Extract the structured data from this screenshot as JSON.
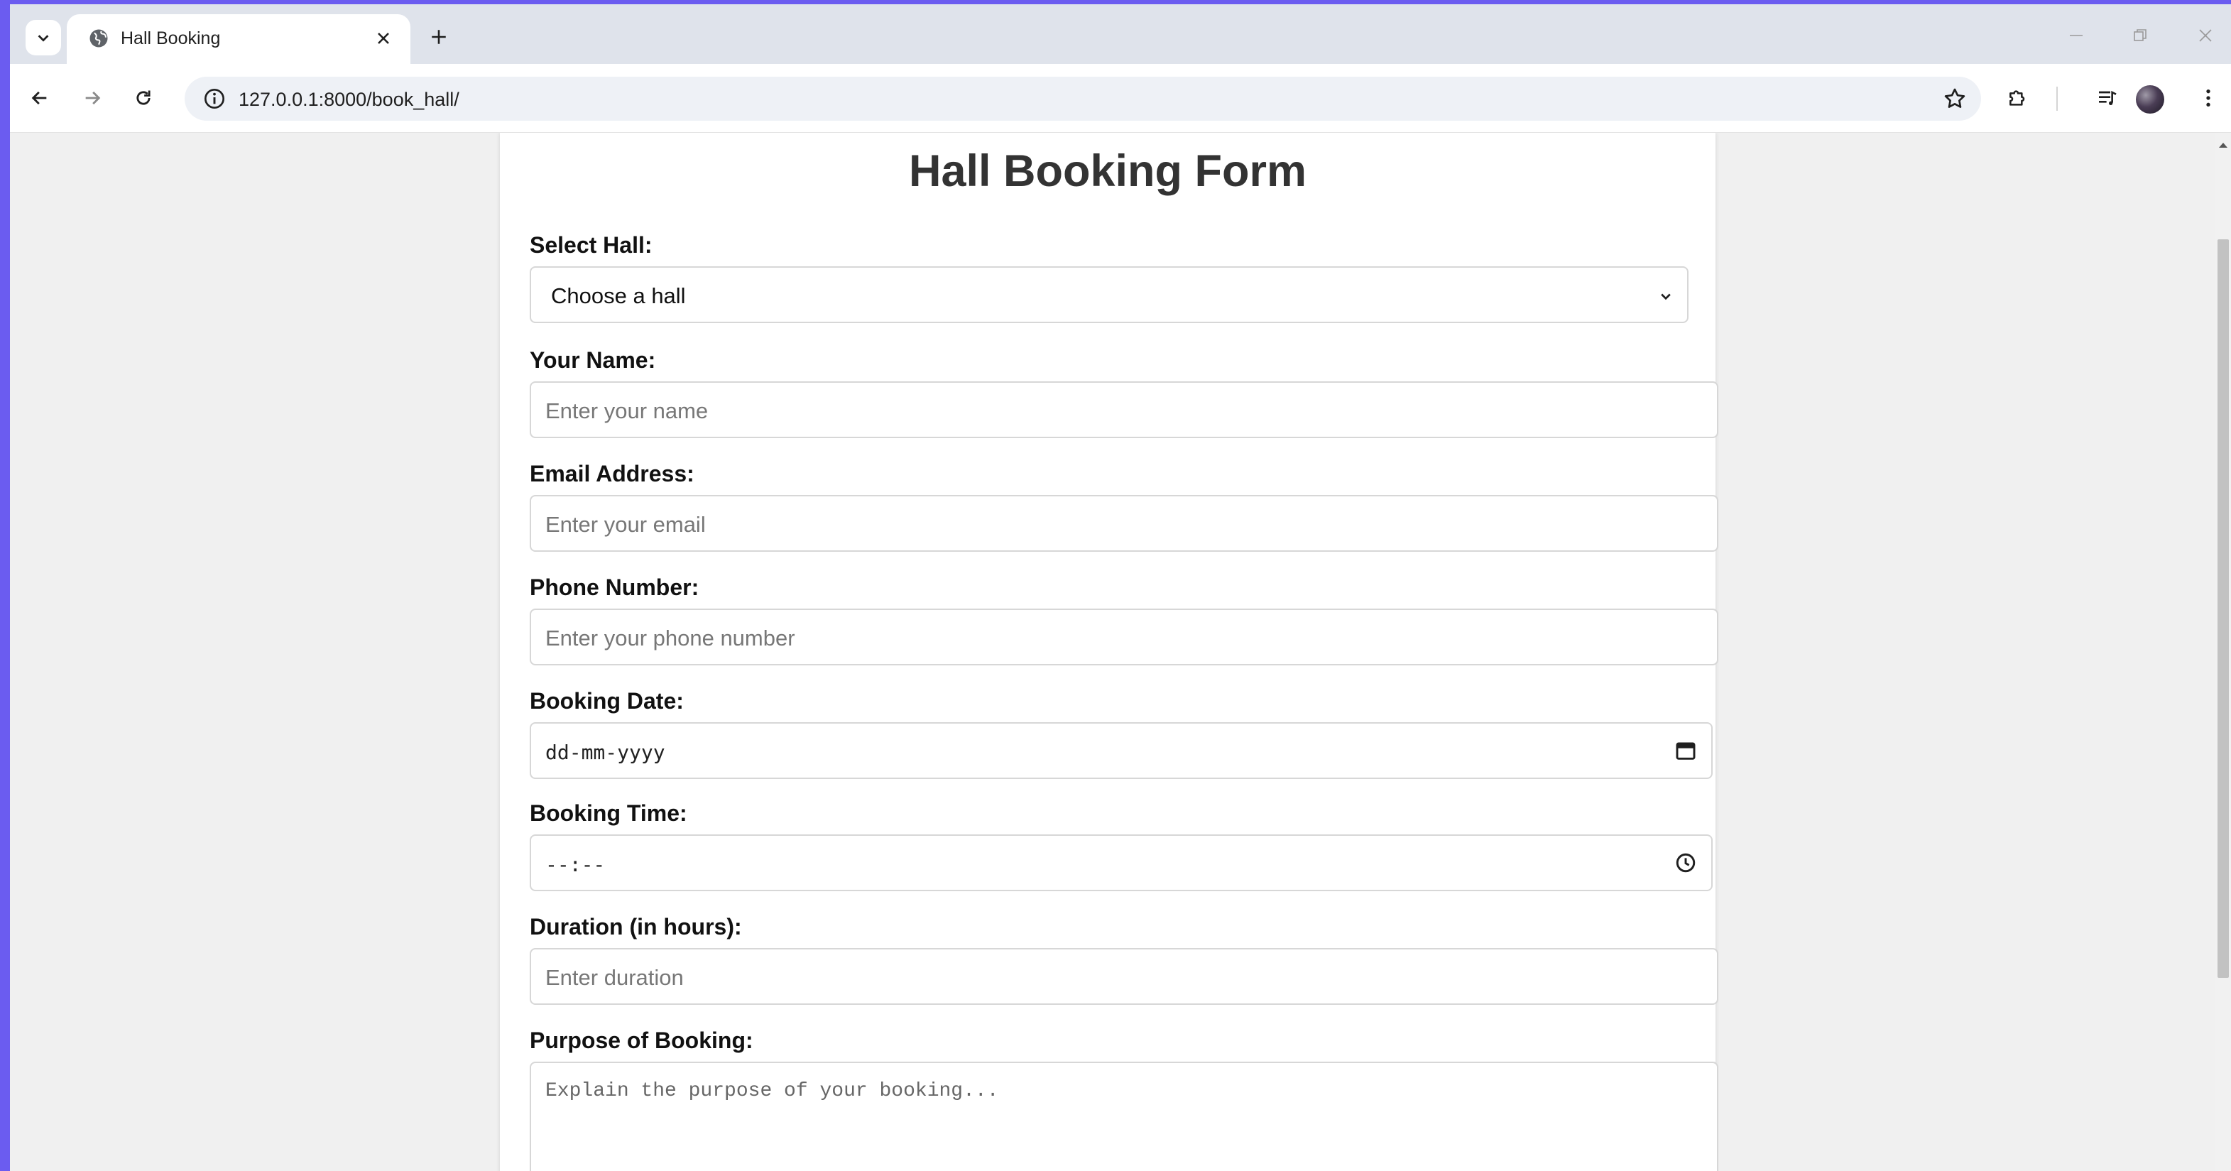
{
  "browser": {
    "tab": {
      "title": "Hall Booking",
      "favicon": "globe-icon"
    },
    "url": "127.0.0.1:8000/book_hall/"
  },
  "form": {
    "title": "Hall Booking Form",
    "hall": {
      "label": "Select Hall:",
      "selected": "Choose a hall"
    },
    "name": {
      "label": "Your Name:",
      "placeholder": "Enter your name"
    },
    "email": {
      "label": "Email Address:",
      "placeholder": "Enter your email"
    },
    "phone": {
      "label": "Phone Number:",
      "placeholder": "Enter your phone number"
    },
    "date": {
      "label": "Booking Date:",
      "value": "dd-mm-yyyy"
    },
    "time": {
      "label": "Booking Time:",
      "value": "--:--"
    },
    "duration": {
      "label": "Duration (in hours):",
      "placeholder": "Enter duration"
    },
    "purpose": {
      "label": "Purpose of Booking:",
      "placeholder": "Explain the purpose of your booking..."
    }
  }
}
